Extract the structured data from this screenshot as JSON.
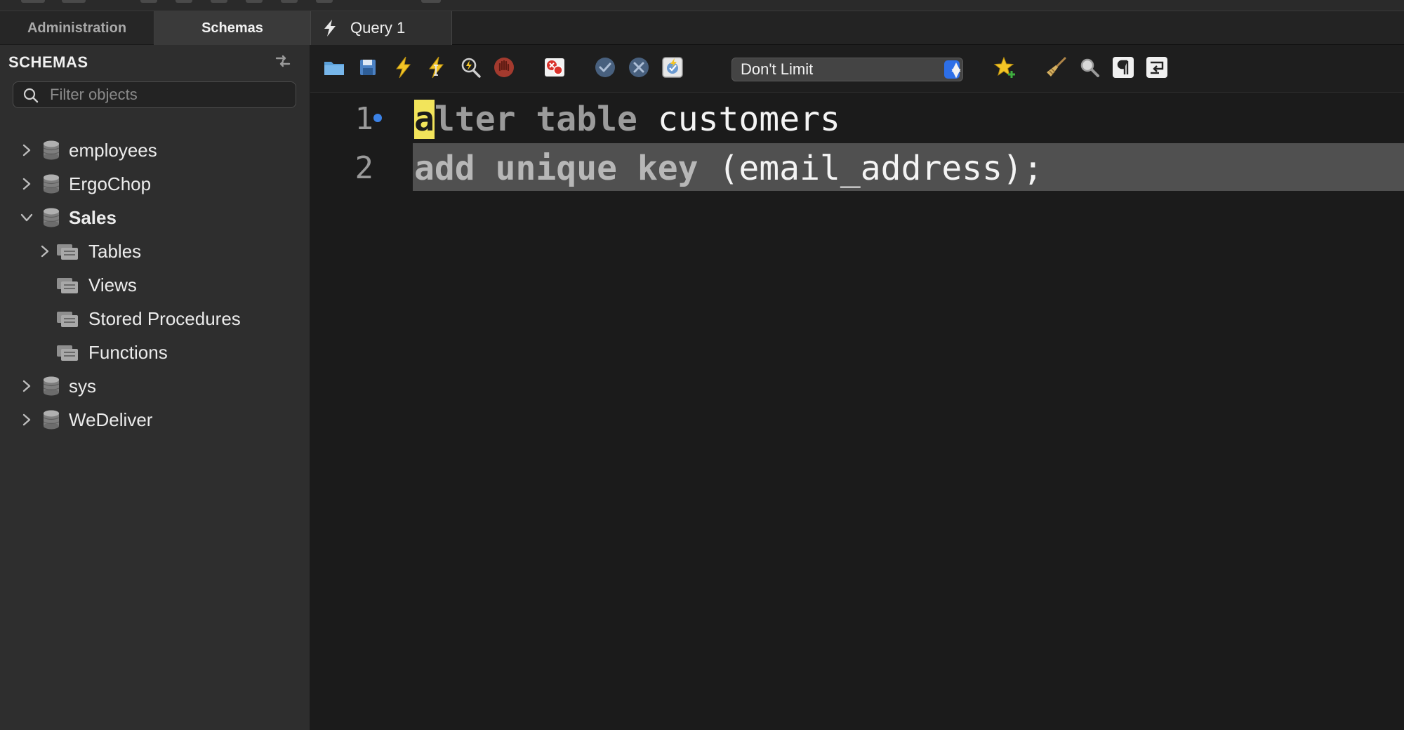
{
  "sidebar": {
    "tabs": [
      {
        "label": "Administration"
      },
      {
        "label": "Schemas"
      }
    ],
    "header": "SCHEMAS",
    "filter_placeholder": "Filter objects",
    "tree": {
      "employees": "employees",
      "ergochop": "ErgoChop",
      "sales": "Sales",
      "tables": "Tables",
      "views": "Views",
      "stored_procedures": "Stored Procedures",
      "functions": "Functions",
      "sys": "sys",
      "wedeliver": "WeDeliver"
    }
  },
  "query_tab": {
    "label": "Query 1"
  },
  "toolbar": {
    "limit_value": "Don't Limit"
  },
  "editor": {
    "line_numbers": [
      "1",
      "2"
    ],
    "line1": {
      "cursor_char": "a",
      "kw1": "lter",
      "kw2": "table",
      "ident": "customers"
    },
    "line2": {
      "kw": "add unique key",
      "ident": "(email_address);"
    }
  },
  "colors": {
    "accent_blue": "#2d6fe8",
    "cursor_yellow": "#f2e45b",
    "line_highlight": "#505050"
  }
}
